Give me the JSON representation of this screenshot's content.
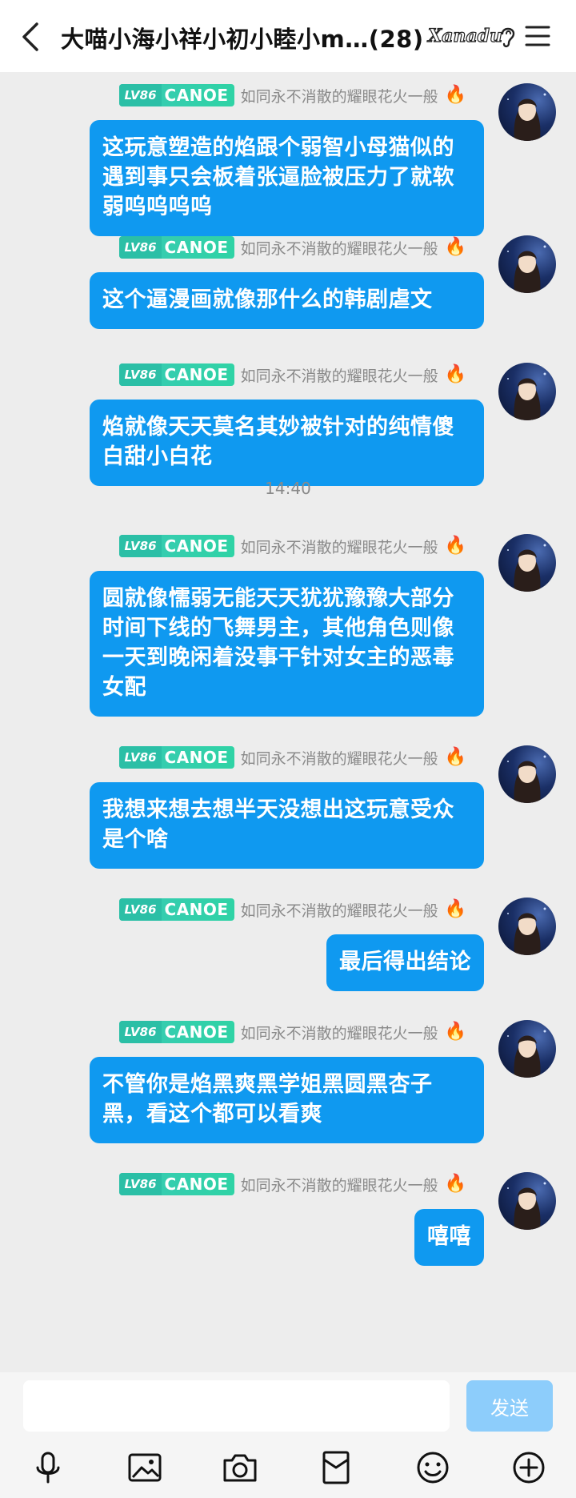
{
  "header": {
    "title": "大喵小海小祥小初小睦小m…(28)",
    "brand": "Xanadu"
  },
  "colors": {
    "bubble": "#0f99f0",
    "badge": "#2fd3a5",
    "send_disabled": "#8dcdfb"
  },
  "messages": [
    {
      "badge_level": "LV86",
      "badge_name": "CANOE",
      "nick": "如同永不消散的耀眼花火一般",
      "fire": "🔥",
      "text": "这玩意塑造的焰跟个弱智小母猫似的遇到事只会板着张逼脸被压力了就软弱呜呜呜呜"
    },
    {
      "badge_level": "LV86",
      "badge_name": "CANOE",
      "nick": "如同永不消散的耀眼花火一般",
      "fire": "🔥",
      "text": "这个逼漫画就像那什么的韩剧虐文"
    },
    {
      "badge_level": "LV86",
      "badge_name": "CANOE",
      "nick": "如同永不消散的耀眼花火一般",
      "fire": "🔥",
      "text": "焰就像天天莫名其妙被针对的纯情傻白甜小白花"
    },
    {
      "badge_level": "LV86",
      "badge_name": "CANOE",
      "nick": "如同永不消散的耀眼花火一般",
      "fire": "🔥",
      "text": "圆就像懦弱无能天天犹犹豫豫大部分时间下线的飞舞男主，其他角色则像一天到晚闲着没事干针对女主的恶毒女配"
    },
    {
      "badge_level": "LV86",
      "badge_name": "CANOE",
      "nick": "如同永不消散的耀眼花火一般",
      "fire": "🔥",
      "text": "我想来想去想半天没想出这玩意受众是个啥"
    },
    {
      "badge_level": "LV86",
      "badge_name": "CANOE",
      "nick": "如同永不消散的耀眼花火一般",
      "fire": "🔥",
      "text": "最后得出结论"
    },
    {
      "badge_level": "LV86",
      "badge_name": "CANOE",
      "nick": "如同永不消散的耀眼花火一般",
      "fire": "🔥",
      "text": "不管你是焰黑爽黑学姐黑圆黑杏子黑，看这个都可以看爽"
    },
    {
      "badge_level": "LV86",
      "badge_name": "CANOE",
      "nick": "如同永不消散的耀眼花火一般",
      "fire": "🔥",
      "text": "嘻嘻"
    }
  ],
  "timestamp": "14:40",
  "input": {
    "placeholder": "",
    "send_label": "发送"
  },
  "toolbar": [
    "mic-icon",
    "image-icon",
    "camera-icon",
    "red-packet-icon",
    "emoji-icon",
    "plus-icon"
  ]
}
